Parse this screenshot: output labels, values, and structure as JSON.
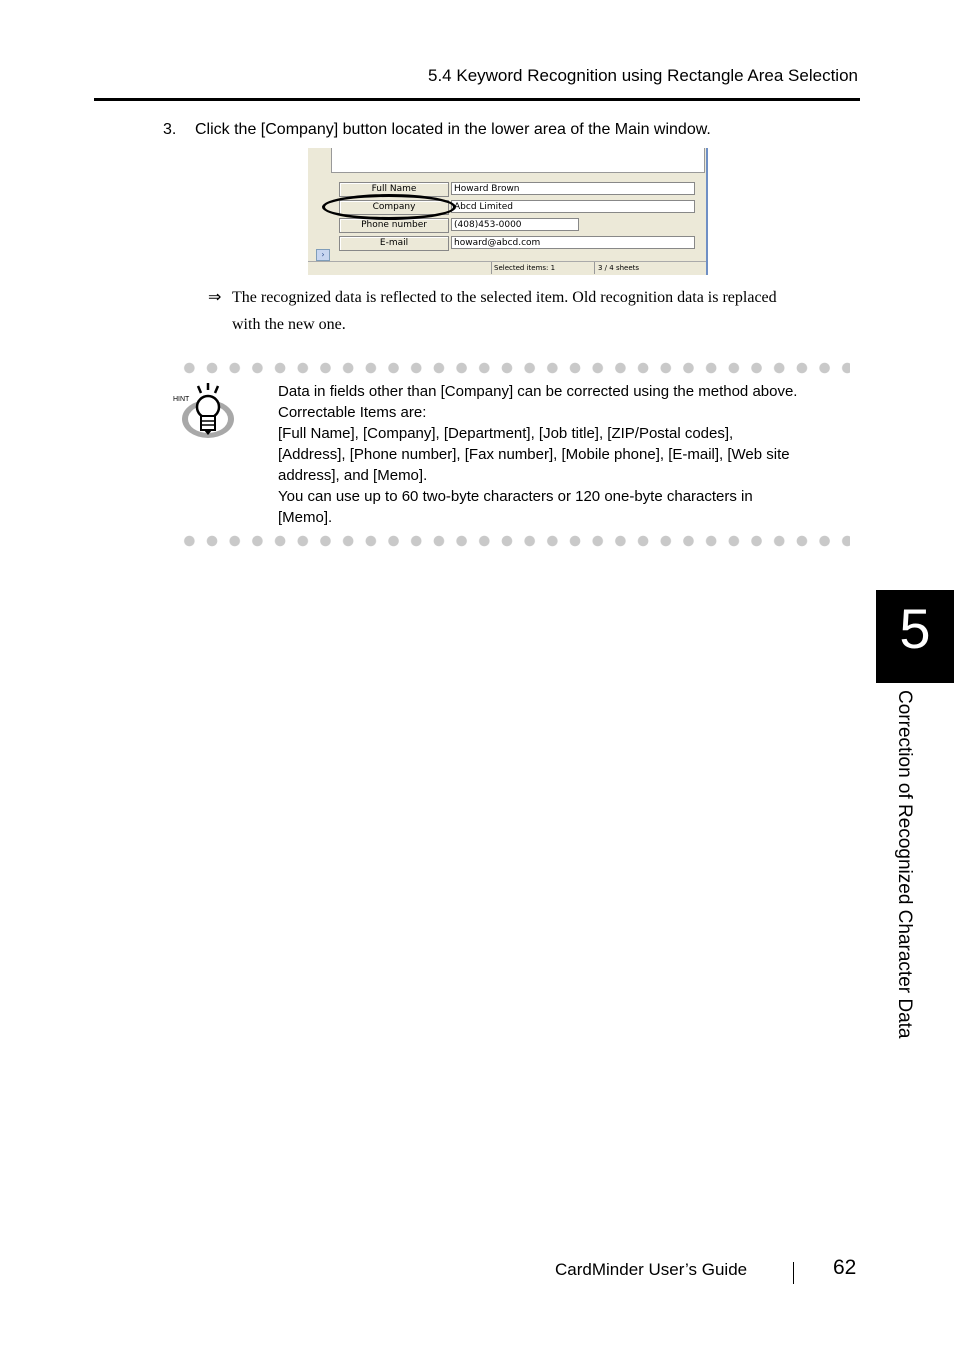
{
  "header": {
    "section_title": "5.4 Keyword Recognition using Rectangle Area Selection"
  },
  "step": {
    "number": "3.",
    "text": "Click the [Company] button located in the lower area of the Main window."
  },
  "screenshot": {
    "fields": [
      {
        "label": "Full Name",
        "value": "Howard Brown"
      },
      {
        "label": "Company",
        "value": "Abcd Limited"
      },
      {
        "label": "Phone number",
        "value": "(408)453-0000"
      },
      {
        "label": "E-mail",
        "value": "howard@abcd.com"
      }
    ],
    "status_selected": "Selected items:    1",
    "status_sheets": "3 /    4 sheets",
    "scroll_glyph": "›"
  },
  "result": {
    "arrow": "⇒",
    "line1": "The recognized data is reflected to the selected item. Old recognition data is replaced",
    "line2": "with the new one."
  },
  "hint": {
    "icon_label": "HINT",
    "lines": [
      "Data in fields other than [Company] can be corrected using the method above.",
      "Correctable Items are:",
      "[Full Name], [Company], [Department], [Job title], [ZIP/Postal codes],",
      "[Address], [Phone number], [Fax number], [Mobile phone], [E-mail], [Web site",
      "address], and [Memo].",
      "You can use up to 60 two-byte characters or 120 one-byte characters in",
      "[Memo]."
    ]
  },
  "chapter": {
    "number": "5",
    "title": "Correction of Recognized Character Data"
  },
  "footer": {
    "guide": "CardMinder  User’s Guide",
    "page": "62"
  }
}
